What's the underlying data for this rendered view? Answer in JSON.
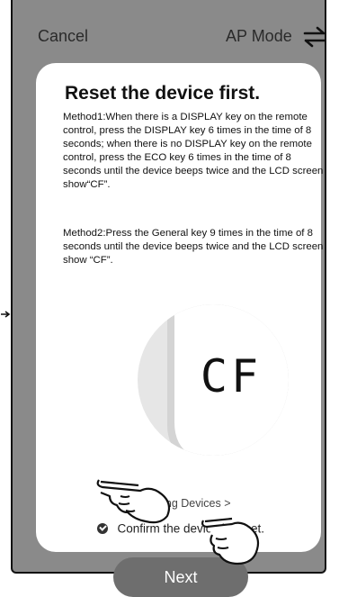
{
  "header": {
    "cancel_label": "Cancel",
    "mode_label": "AP Mode",
    "swap_icon": "swap-arrows-icon"
  },
  "card": {
    "title": "Reset the device first.",
    "method1": "Method1:When there is a DISPLAY key on the remote control, press the DISPLAY key 6 times in the time of 8 seconds; when there is no DISPLAY key on the remote control, press the ECO key 6 times in the time of 8 seconds until the device beeps twice and the LCD screen show“CF”.",
    "method2": "Method2:Press the General key 9 times in the time of 8 seconds until the device beeps twice and the LCD screen show “CF”.",
    "display_text": "CF",
    "resetting_link": "Resetting Devices >",
    "confirm_label": "Confirm the device is reset.",
    "next_label": "Next"
  },
  "colors": {
    "frame": "#8a8a8a",
    "card": "#ffffff",
    "button": "#6e6e6e"
  }
}
